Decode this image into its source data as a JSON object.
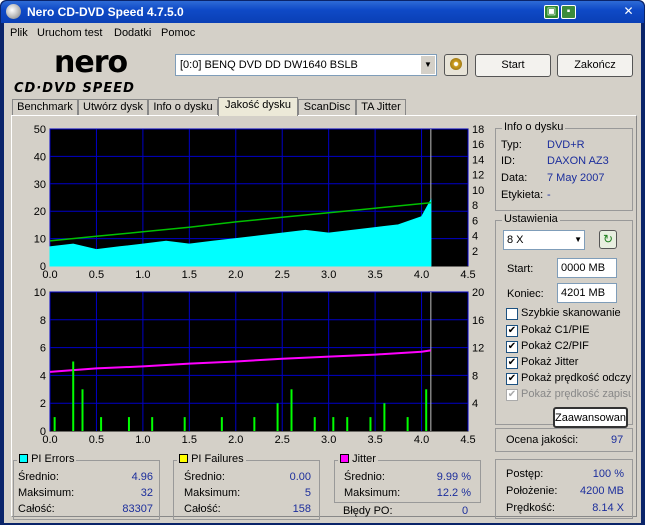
{
  "window": {
    "title": "Nero CD-DVD Speed 4.7.5.0"
  },
  "menu": [
    "Plik",
    "Uruchom test",
    "Dodatki",
    "Pomoc"
  ],
  "logo": {
    "line1": "nero",
    "line2": "CD·DVD SPEED"
  },
  "drive": {
    "selected": "[0:0]  BENQ DVD DD DW1640 BSLB"
  },
  "buttons": {
    "start": "Start",
    "end": "Zakończ",
    "advanced": "Zaawansowane"
  },
  "tabs": [
    "Benchmark",
    "Utwórz dysk",
    "Info o dysku",
    "Jakość dysku",
    "ScanDisc",
    "TA Jitter"
  ],
  "active_tab": "Jakość dysku",
  "disc_info": {
    "title": "Info o dysku",
    "rows": [
      {
        "label": "Typ:",
        "value": "DVD+R"
      },
      {
        "label": "ID:",
        "value": "DAXON AZ3"
      },
      {
        "label": "Data:",
        "value": "7 May 2007"
      },
      {
        "label": "Etykieta:",
        "value": "-"
      }
    ]
  },
  "settings": {
    "title": "Ustawienia",
    "speed": "8 X",
    "start_label": "Start:",
    "start_value": "0000 MB",
    "end_label": "Koniec:",
    "end_value": "4201 MB",
    "options": [
      {
        "label": "Szybkie skanowanie",
        "checked": false,
        "enabled": true
      },
      {
        "label": "Pokaż C1/PIE",
        "checked": true,
        "enabled": true
      },
      {
        "label": "Pokaż C2/PIF",
        "checked": true,
        "enabled": true
      },
      {
        "label": "Pokaż Jitter",
        "checked": true,
        "enabled": true
      },
      {
        "label": "Pokaż prędkość odczytu",
        "checked": true,
        "enabled": true
      },
      {
        "label": "Pokaż prędkość zapisu",
        "checked": true,
        "enabled": false
      }
    ]
  },
  "quality": {
    "label": "Ocena jakości:",
    "value": "97"
  },
  "pi_errors": {
    "title": "PI Errors",
    "color": "#00ffff",
    "rows": [
      {
        "label": "Średnio:",
        "value": "4.96"
      },
      {
        "label": "Maksimum:",
        "value": "32"
      },
      {
        "label": "Całość:",
        "value": "83307"
      }
    ]
  },
  "pi_failures": {
    "title": "PI Failures",
    "color": "#ffff00",
    "rows": [
      {
        "label": "Średnio:",
        "value": "0.00"
      },
      {
        "label": "Maksimum:",
        "value": "5"
      },
      {
        "label": "Całość:",
        "value": "158"
      }
    ]
  },
  "jitter": {
    "title": "Jitter",
    "color": "#ff00ff",
    "rows": [
      {
        "label": "Średnio:",
        "value": "9.99 %"
      },
      {
        "label": "Maksimum:",
        "value": "12.2 %"
      }
    ],
    "po_label": "Błędy PO:",
    "po_value": "0"
  },
  "progress": {
    "rows": [
      {
        "label": "Postęp:",
        "value": "100 %"
      },
      {
        "label": "Położenie:",
        "value": "4200 MB"
      },
      {
        "label": "Prędkość:",
        "value": "8.14 X"
      }
    ]
  },
  "chart_data": [
    {
      "type": "area",
      "title": "",
      "xlim": [
        0,
        4.5
      ],
      "xticks": [
        "0.0",
        "0.5",
        "1.0",
        "1.5",
        "2.0",
        "2.5",
        "3.0",
        "3.5",
        "4.0",
        "4.5"
      ],
      "ylim_left": [
        0,
        50
      ],
      "yticks_left": [
        "10",
        "20",
        "30",
        "40",
        "50"
      ],
      "ylim_right": [
        0,
        18
      ],
      "yticks_right": [
        "2",
        "4",
        "6",
        "8",
        "10",
        "12",
        "14",
        "16",
        "18"
      ],
      "series": [
        {
          "name": "PI Errors",
          "color": "#00ffff",
          "x": [
            0,
            0.25,
            0.5,
            0.75,
            1,
            1.25,
            1.5,
            1.75,
            2,
            2.25,
            2.5,
            2.75,
            3,
            3.25,
            3.5,
            3.75,
            4,
            4.1
          ],
          "y": [
            7,
            8,
            6,
            7,
            8,
            9,
            8,
            9,
            10,
            11,
            12,
            13,
            12,
            13,
            14,
            15,
            18,
            24
          ]
        },
        {
          "name": "Read speed",
          "color": "#00c000",
          "x": [
            0,
            0.5,
            1,
            1.5,
            2,
            2.5,
            3,
            3.5,
            4,
            4.1
          ],
          "y": [
            3.3,
            3.9,
            4.5,
            5.1,
            5.8,
            6.4,
            7.0,
            7.6,
            8.2,
            8.3
          ]
        }
      ]
    },
    {
      "type": "line",
      "title": "",
      "xlim": [
        0,
        4.5
      ],
      "xticks": [
        "0.0",
        "0.5",
        "1.0",
        "1.5",
        "2.0",
        "2.5",
        "3.0",
        "3.5",
        "4.0",
        "4.5"
      ],
      "ylim_left": [
        0,
        10
      ],
      "yticks_left": [
        "2",
        "4",
        "6",
        "8",
        "10"
      ],
      "ylim_right": [
        0,
        20
      ],
      "yticks_right": [
        "4",
        "8",
        "12",
        "16",
        "20"
      ],
      "series": [
        {
          "name": "Jitter",
          "color": "#ff00ff",
          "x": [
            0,
            0.5,
            1,
            1.5,
            2,
            2.5,
            3,
            3.5,
            4,
            4.1
          ],
          "y": [
            8.5,
            9.0,
            9.3,
            9.7,
            10.0,
            10.4,
            10.7,
            11.0,
            11.4,
            11.6
          ]
        },
        {
          "name": "PI Failures",
          "color": "#00ff00",
          "x": [
            0.05,
            0.25,
            0.35,
            0.55,
            0.85,
            1.1,
            1.45,
            1.85,
            2.2,
            2.45,
            2.6,
            2.85,
            3.05,
            3.2,
            3.45,
            3.6,
            3.85,
            4.05
          ],
          "y": [
            1,
            5,
            3,
            1,
            1,
            1,
            1,
            1,
            1,
            2,
            3,
            1,
            1,
            1,
            1,
            2,
            1,
            3
          ]
        }
      ]
    }
  ]
}
